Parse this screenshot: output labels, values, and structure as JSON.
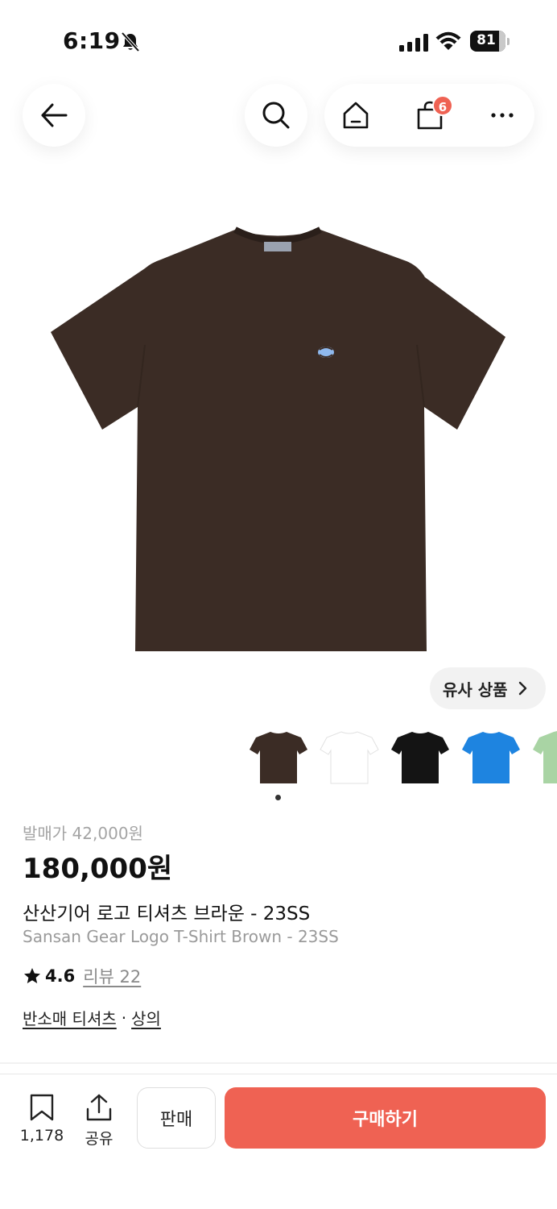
{
  "status_bar": {
    "time": "6:19",
    "battery": "81",
    "battery_level": 0.81,
    "icons": [
      "bell-slash-icon",
      "signal-icon",
      "wifi-icon",
      "battery-icon"
    ]
  },
  "header": {
    "back_icon": "arrow-left-icon",
    "search_icon": "search-icon",
    "home_icon": "home-icon",
    "cart_icon": "shopping-bag-icon",
    "cart_count": "6",
    "more_icon": "more-horizontal-icon"
  },
  "product": {
    "image_icon": "brown-tshirt",
    "similar_label": "유사 상품",
    "thumbnails": [
      {
        "color": "brown",
        "hex": "#3b2c25"
      },
      {
        "color": "white",
        "hex": "#ffffff"
      },
      {
        "color": "black",
        "hex": "#141414"
      },
      {
        "color": "blue",
        "hex": "#1e84e0"
      },
      {
        "color": "mint",
        "hex": "#a9d4a4"
      }
    ],
    "release_price": "발매가 42,000원",
    "price": "180,000원",
    "name_ko": "산산기어 로고 티셔츠 브라운 - 23SS",
    "name_en": "Sansan Gear Logo T-Shirt Brown - 23SS",
    "rating": "4.6",
    "review_label": "리뷰 22",
    "category": "반소매 티셔츠",
    "category_separator": "·",
    "parent_category": "상의"
  },
  "bottom_bar": {
    "bookmark_count": "1,178",
    "share_label": "공유",
    "sell_label": "판매",
    "buy_label": "구매하기"
  },
  "colors": {
    "accent": "#ef6253",
    "tshirt": "#3b2c25"
  }
}
